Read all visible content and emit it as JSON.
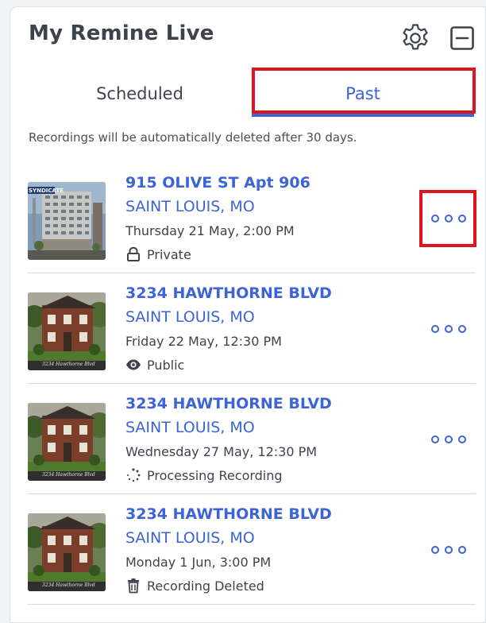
{
  "header": {
    "title": "My Remine Live",
    "settings_icon": "gear-icon",
    "minimize_icon": "minimize-icon"
  },
  "tabs": [
    {
      "label": "Scheduled",
      "active": false
    },
    {
      "label": "Past",
      "active": true
    }
  ],
  "notice": "Recordings will be automatically deleted after 30 days.",
  "recordings": [
    {
      "street": "915 OLIVE ST Apt 906",
      "city": "SAINT LOUIS, MO",
      "date": "Thursday 21 May, 2:00 PM",
      "status": "Private",
      "status_icon": "lock-icon",
      "thumbnail": "office-building",
      "thumbnail_text": "SYNDICATE",
      "highlighted_menu": true
    },
    {
      "street": "3234 HAWTHORNE BLVD",
      "city": "SAINT LOUIS, MO",
      "date": "Friday 22 May, 12:30 PM",
      "status": "Public",
      "status_icon": "eye-icon",
      "thumbnail": "brick-house",
      "thumbnail_text": "3234 Hawthorne Blvd"
    },
    {
      "street": "3234 HAWTHORNE BLVD",
      "city": "SAINT LOUIS, MO",
      "date": "Wednesday 27 May, 12:30 PM",
      "status": "Processing Recording",
      "status_icon": "spinner-icon",
      "thumbnail": "brick-house",
      "thumbnail_text": "3234 Hawthorne Blvd"
    },
    {
      "street": "3234 HAWTHORNE BLVD",
      "city": "SAINT LOUIS, MO",
      "date": "Monday 1 Jun, 3:00 PM",
      "status": "Recording Deleted",
      "status_icon": "trash-icon",
      "thumbnail": "brick-house",
      "thumbnail_text": "3234 Hawthorne Blvd"
    }
  ],
  "more_menu_icon": "more-options-icon",
  "colors": {
    "accent": "#3c64d8",
    "text": "#3e434b",
    "highlight": "#e0131e",
    "divider": "#d6d9de"
  }
}
